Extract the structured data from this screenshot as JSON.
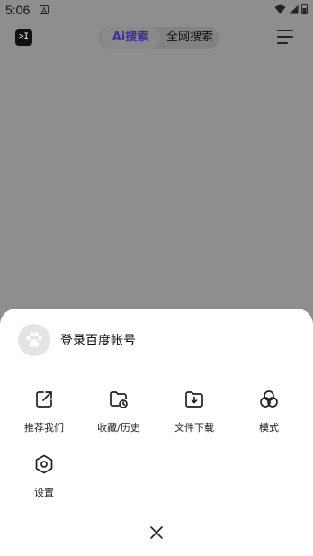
{
  "status_bar": {
    "time": "5:06",
    "notification_glyph": "A"
  },
  "header": {
    "app_icon_text": ">I",
    "tabs": [
      {
        "label": "Ai搜索",
        "active": true
      },
      {
        "label": "全网搜索",
        "active": false
      }
    ],
    "accent_color": "#3f2f9a"
  },
  "sheet": {
    "login_label": "登录百度帐号",
    "actions": [
      {
        "label": "推荐我们",
        "icon": "share-icon"
      },
      {
        "label": "收藏/历史",
        "icon": "folder-clock-icon"
      },
      {
        "label": "文件下载",
        "icon": "folder-download-icon"
      },
      {
        "label": "模式",
        "icon": "circles-icon"
      },
      {
        "label": "设置",
        "icon": "settings-hexagon-icon"
      }
    ]
  }
}
